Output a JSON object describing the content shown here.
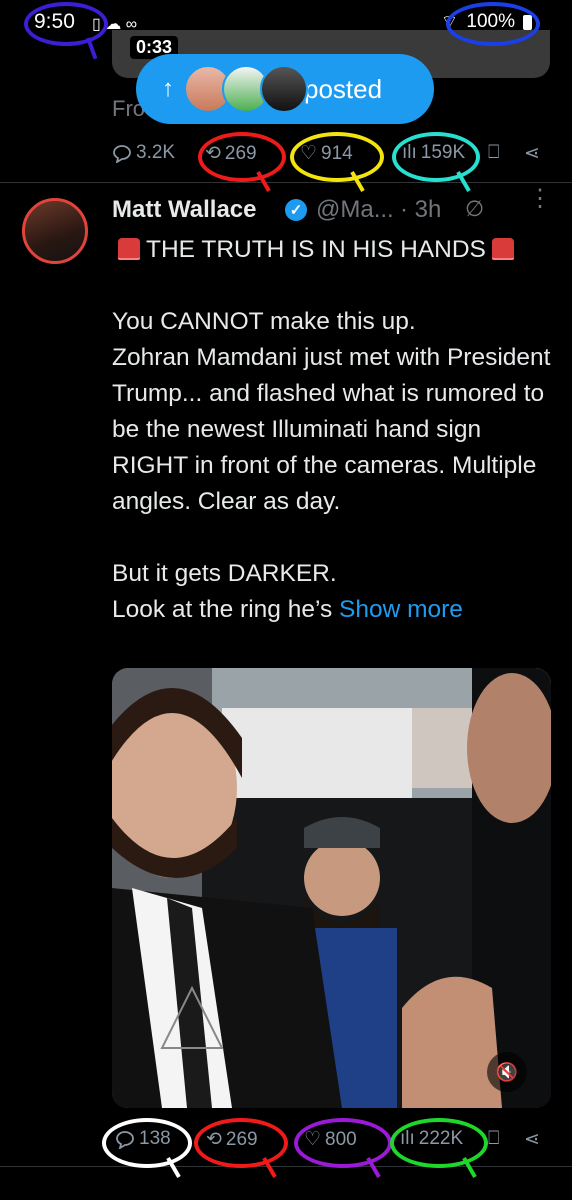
{
  "status_bar": {
    "time": "9:50",
    "battery": "100%"
  },
  "prev_tweet": {
    "video_time": "0:33",
    "truncated_text": "Fro",
    "replies": "3.2K",
    "reposts": "269",
    "likes": "914",
    "views": "159K"
  },
  "new_posts_pill": {
    "label": "posted"
  },
  "tweet": {
    "author_name": "Matt Wallace",
    "handle": "@Ma...",
    "time": "· 3h",
    "headline": "THE TRUTH IS IN HIS HANDS",
    "para1_line1": "You CANNOT make this up.",
    "para1_rest": "Zohran Mamdani just met with President Trump... and flashed what is rumored to be the newest Illuminati hand sign RIGHT in front of the cameras. Multiple angles. Clear as day.",
    "para2_line1": "But it gets DARKER.",
    "para2_rest": "Look at the ring he’s",
    "show_more": "Show more",
    "stats": {
      "replies": "138",
      "reposts": "269",
      "likes": "800",
      "views": "222K"
    }
  },
  "annotation_colors": {
    "time": "#3b1fd6",
    "battery": "#1b3fe6",
    "reposts": "#ef1a1a",
    "likes": "#f2e40c",
    "views": "#28e0d0",
    "replies_bottom": "#ffffff",
    "likes_bottom": "#9a1ad6",
    "views_bottom": "#1fd62a"
  }
}
